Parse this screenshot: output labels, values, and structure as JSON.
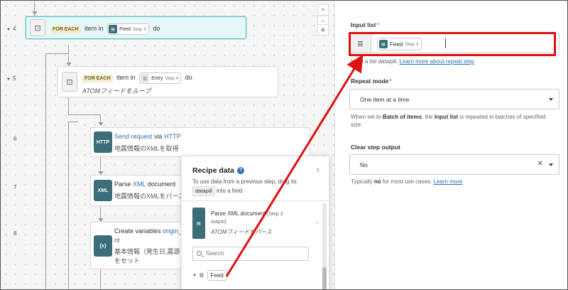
{
  "steps": [
    {
      "num": "4",
      "keyword": "FOR EACH",
      "text1": "item in",
      "pill": "Feed",
      "pill_sub": "Step 3",
      "text2": "do"
    },
    {
      "num": "5",
      "keyword": "FOR EACH",
      "text1": "item in",
      "pill": "Entry",
      "pill_sub": "Step 4",
      "text2": "do",
      "desc": "ATOMフィードをループ"
    },
    {
      "num": "6",
      "action_link1": "Send request",
      "action_mid": "via",
      "action_link2": "HTTP",
      "desc": "地震情報のXMLを取得",
      "icon": "HTTP"
    },
    {
      "num": "7",
      "action_pre": "Parse",
      "action_link1": "XML",
      "action_post": "document",
      "desc": "地震情報のXMLをパース",
      "icon": "XML"
    },
    {
      "num": "8",
      "action_pre": "Create variables",
      "action_link1": "origin_ti",
      "action_cont": "nt",
      "desc": "基本情報（発生日,震源",
      "desc2": "をセット",
      "icon": "{x}"
    }
  ],
  "zoom": {
    "plus": "+",
    "minus": "−"
  },
  "recipe": {
    "title": "Recipe data",
    "desc_a": "To use data from a previous step, drag its",
    "desc_pill": "datapill",
    "desc_b": "into a field",
    "source_title": "Parse XML document",
    "source_step": "(Step 3",
    "source_output": "output)",
    "source_desc": "ATOMフィードをパース",
    "search_placeholder": "Search",
    "feed_label": "Feed"
  },
  "panel": {
    "input_list_label": "Input list",
    "input_pill": "Feed",
    "input_pill_sub": "Step 3",
    "input_hint_a": "Input a list datapill.",
    "input_hint_link": "Learn more about repeat step",
    "repeat_label": "Repeat mode",
    "repeat_value": "One item at a time",
    "repeat_hint_a": "When set to",
    "repeat_hint_b1": "Batch of items",
    "repeat_hint_c": ", the",
    "repeat_hint_b2": "Input list",
    "repeat_hint_d": "is repeated in batches of specified",
    "repeat_hint_e": "size",
    "clear_label": "Clear step output",
    "clear_value": "No",
    "clear_hint_a": "Typically",
    "clear_hint_b": "no",
    "clear_hint_c": "for most use cases.",
    "clear_hint_link": "Learn more"
  },
  "colors": {
    "accent_teal": "#3c6e7a",
    "annotation_red": "#e01010",
    "link": "#2f6fb3"
  }
}
